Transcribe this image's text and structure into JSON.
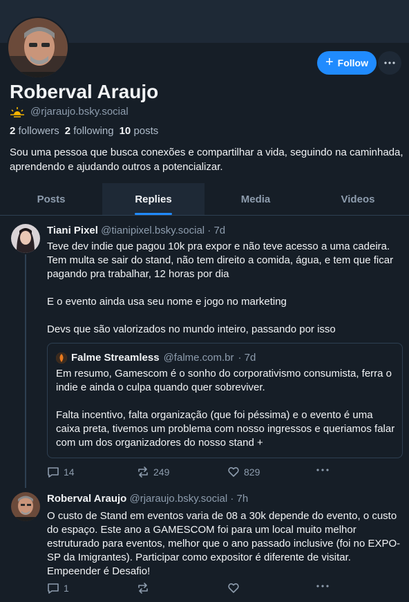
{
  "profile": {
    "display_name": "Roberval Araujo",
    "handle": "@rjaraujo.bsky.social",
    "handle_emoji": "☀",
    "followers_count": "2",
    "followers_label": "followers",
    "following_count": "2",
    "following_label": "following",
    "posts_count": "10",
    "posts_label": "posts",
    "bio": "Sou uma pessoa que busca conexões e compartilhar a vida, seguindo na caminhada, aprendendo e ajudando outros a potencializar.",
    "follow_label": "Follow"
  },
  "tabs": [
    {
      "label": "Posts",
      "active": false
    },
    {
      "label": "Replies",
      "active": true
    },
    {
      "label": "Media",
      "active": false
    },
    {
      "label": "Videos",
      "active": false
    }
  ],
  "posts": [
    {
      "author": "Tiani Pixel",
      "handle": "@tianipixel.bsky.social",
      "time": "· 7d",
      "paragraphs": [
        "Teve dev indie que pagou 10k pra expor e não teve acesso a uma cadeira. Tem multa se sair do stand, não tem direito a comida, água, e tem que ficar pagando pra trabalhar, 12 horas por dia",
        "E o evento ainda usa seu nome e jogo no marketing",
        "Devs que são valorizados no mundo inteiro, passando por isso"
      ],
      "quote": {
        "author": "Falme Streamless",
        "handle": "@falme.com.br",
        "time": "· 7d",
        "paragraphs": [
          "Em resumo, Gamescom é o sonho do corporativismo consumista, ferra o indie e ainda o culpa quando quer sobreviver.",
          "Falta incentivo, falta organização (que foi péssima) e o evento é uma caixa preta, tivemos um problema com nosso ingressos e queriamos falar com um dos organizadores do nosso stand +"
        ]
      },
      "replies": "14",
      "reposts": "249",
      "likes": "829"
    },
    {
      "author": "Roberval Araujo",
      "handle": "@rjaraujo.bsky.social",
      "time": "· 7h",
      "paragraphs": [
        "O custo de Stand em eventos varia de 08 a 30k depende do evento, o custo do espaço. Este ano a GAMESCOM foi para um local muito melhor estruturado para eventos, melhor que o ano passado inclusive (foi no EXPO-SP da Imigrantes). Participar como expositor é diferente de visitar. Empeender é Desafio!"
      ],
      "replies": "1",
      "reposts": "",
      "likes": ""
    }
  ],
  "colors": {
    "background": "#161e27",
    "banner": "#1e2936",
    "accent": "#208bfe",
    "muted_text": "#8d9cad",
    "border": "#2e4052"
  },
  "icons": [
    "plus-icon",
    "ellipsis-icon",
    "sun-emoji-icon",
    "reply-icon",
    "repost-icon",
    "like-icon",
    "more-options-icon"
  ]
}
